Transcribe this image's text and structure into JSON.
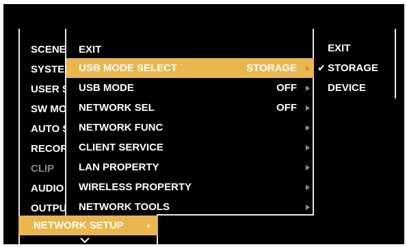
{
  "left_menu": {
    "items": [
      {
        "label": "SCENE FILE",
        "enabled": true
      },
      {
        "label": "SYSTEM",
        "enabled": true
      },
      {
        "label": "USER SW",
        "enabled": true
      },
      {
        "label": "SW MODE",
        "enabled": true
      },
      {
        "label": "AUTO SW",
        "enabled": true
      },
      {
        "label": "RECORDING",
        "enabled": true
      },
      {
        "label": "CLIP",
        "enabled": false
      },
      {
        "label": "AUDIO",
        "enabled": true
      },
      {
        "label": "OUTPUT",
        "enabled": true
      }
    ],
    "selected": {
      "label": "NETWORK SETUP"
    },
    "scroll_more": "v"
  },
  "mid_menu": {
    "items": [
      {
        "label": "EXIT",
        "value": "",
        "has_submenu": false
      },
      {
        "label": "USB MODE SELECT",
        "value": "STORAGE",
        "has_submenu": true,
        "selected": true
      },
      {
        "label": "USB MODE",
        "value": "OFF",
        "has_submenu": true
      },
      {
        "label": "NETWORK SEL",
        "value": "OFF",
        "has_submenu": true
      },
      {
        "label": "NETWORK FUNC",
        "value": "",
        "has_submenu": true
      },
      {
        "label": "CLIENT SERVICE",
        "value": "",
        "has_submenu": true
      },
      {
        "label": "LAN PROPERTY",
        "value": "",
        "has_submenu": true
      },
      {
        "label": "WIRELESS PROPERTY",
        "value": "",
        "has_submenu": true
      },
      {
        "label": "NETWORK TOOLS",
        "value": "",
        "has_submenu": true
      }
    ]
  },
  "right_menu": {
    "items": [
      {
        "label": "EXIT",
        "checked": false
      },
      {
        "label": "STORAGE",
        "checked": true
      },
      {
        "label": "DEVICE",
        "checked": false
      }
    ],
    "check_glyph": "✔"
  },
  "colors": {
    "background": "#000000",
    "highlight": "#e9b64f",
    "text": "#ffffff",
    "disabled_text": "#8a8a8a"
  }
}
